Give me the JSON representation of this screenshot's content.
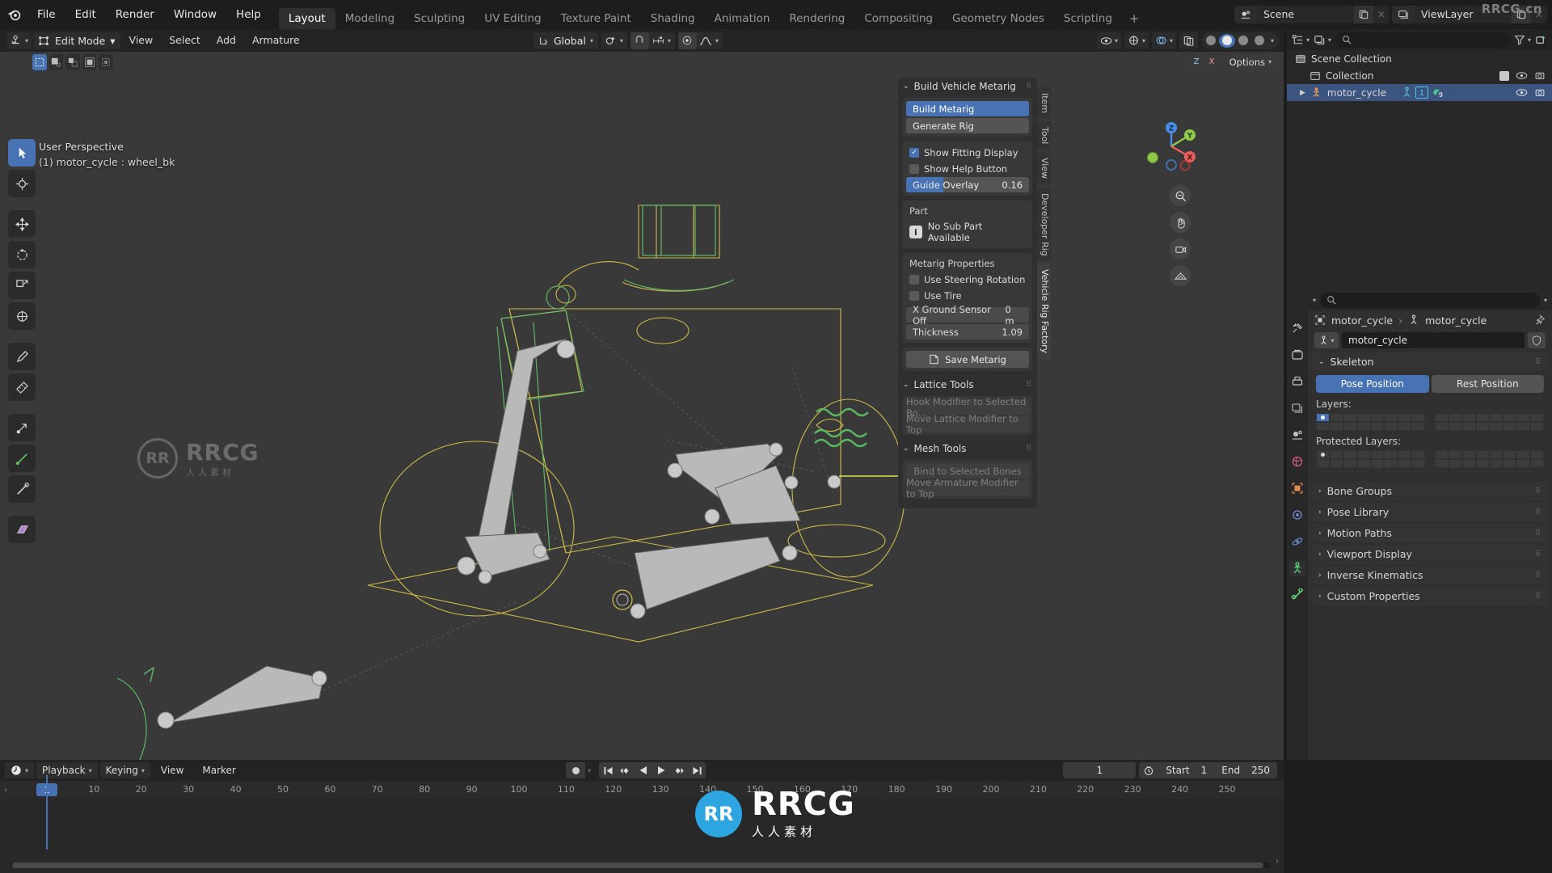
{
  "app": {
    "name": "Blender",
    "logo_icon": "blender-logo-icon"
  },
  "topbar": {
    "menus": [
      "File",
      "Edit",
      "Render",
      "Window",
      "Help"
    ],
    "workspace_tabs": [
      {
        "label": "Layout",
        "active": true
      },
      {
        "label": "Modeling",
        "active": false
      },
      {
        "label": "Sculpting",
        "active": false
      },
      {
        "label": "UV Editing",
        "active": false
      },
      {
        "label": "Texture Paint",
        "active": false
      },
      {
        "label": "Shading",
        "active": false
      },
      {
        "label": "Animation",
        "active": false
      },
      {
        "label": "Rendering",
        "active": false
      },
      {
        "label": "Compositing",
        "active": false
      },
      {
        "label": "Geometry Nodes",
        "active": false
      },
      {
        "label": "Scripting",
        "active": false
      }
    ],
    "add_workspace_label": "+",
    "scene": {
      "icon": "scene-icon",
      "name": "Scene",
      "new_label": "",
      "remove_label": "×"
    },
    "view_layer": {
      "icon": "view-layer-icon",
      "name": "ViewLayer",
      "new_label": "",
      "remove_label": "×"
    },
    "watermark": "RRCG.cn"
  },
  "viewport": {
    "mode": "Edit Mode",
    "menus": [
      "View",
      "Select",
      "Add",
      "Armature"
    ],
    "transform_orientation": "Global",
    "pivot_icon": "pivot-point-icon",
    "snap_icon": "snap-magnet-icon",
    "proportional_icon": "proportional-edit-icon",
    "falloff_icon": "falloff-curve-icon",
    "overlay_text_line1": "User Perspective",
    "overlay_text_line2": "(1) motor_cycle : wheel_bk",
    "select_modes": [
      "box-select-icon",
      "vertex-select-icon",
      "edge-select-icon",
      "face-select-icon",
      "extend-select-icon"
    ],
    "options_label": "Options",
    "gizmo_axes": [
      {
        "label": "Z",
        "color": "#4b8ee8"
      },
      {
        "label": "Y",
        "color": "#8fc94b"
      },
      {
        "label": "X",
        "color": "#e8615f"
      }
    ],
    "nav_buttons": [
      "zoom-icon",
      "pan-hand-icon",
      "camera-icon",
      "grid-ortho-icon"
    ],
    "shading_modes": [
      "wireframe-shading",
      "solid-shading",
      "material-shading",
      "rendered-shading"
    ],
    "active_shading_index": 1,
    "watermark_left": {
      "logo": "RR",
      "text": "RRCG",
      "sub": "人人素材"
    },
    "watermark_big": {
      "logo": "RR",
      "text": "RRCG",
      "sub": "人人素材"
    }
  },
  "sidebar_tabs": [
    {
      "label": "Item",
      "selected": false
    },
    {
      "label": "Tool",
      "selected": false
    },
    {
      "label": "View",
      "selected": false
    },
    {
      "label": "Developer Rig",
      "selected": false
    },
    {
      "label": "Vehicle Rig Factory",
      "selected": true
    }
  ],
  "npanel": {
    "sections": [
      {
        "title": "Build Vehicle Metarig",
        "collapsed": false,
        "buttons": [
          {
            "label": "Build Metarig",
            "highlight": true
          },
          {
            "label": "Generate Rig",
            "highlight": false
          }
        ],
        "checkboxes": [
          {
            "label": "Show Fitting Display",
            "checked": true
          },
          {
            "label": "Show Help Button",
            "checked": false
          }
        ],
        "slider": {
          "label": "Guide Overlay",
          "value": "0.16",
          "fill_percent": 30
        },
        "part_group": {
          "title": "Part",
          "info_icon": "info-icon",
          "info_text": "No Sub Part Available"
        },
        "metarig_props": {
          "title": "Metarig Properties",
          "checkboxes": [
            {
              "label": "Use Steering Rotation",
              "checked": false
            },
            {
              "label": "Use Tire",
              "checked": false
            }
          ],
          "fields": [
            {
              "label": "X Ground Sensor Off",
              "value": "0 m"
            },
            {
              "label": "Thickness",
              "value": "1.09"
            }
          ]
        },
        "save_button": {
          "label": "Save Metarig",
          "icon": "save-file-icon"
        }
      },
      {
        "title": "Lattice Tools",
        "collapsed": false,
        "disabled_buttons": [
          "Hook Modifier to Selected Bo...",
          "Move Lattice Modifier to Top"
        ]
      },
      {
        "title": "Mesh Tools",
        "collapsed": false,
        "disabled_buttons": [
          "Bind to Selected Bones",
          "Move Armature Modifier to Top"
        ]
      }
    ]
  },
  "outliner": {
    "display_mode_icon": "outliner-display-icon",
    "filter_icon": "filter-funnel-icon",
    "new_collection_icon": "new-collection-icon",
    "search_placeholder": "",
    "rows": [
      {
        "label": "Scene Collection",
        "icon": "scene-collection-icon",
        "indent": 0,
        "selected": false,
        "has_checkbox": false,
        "has_eye": false,
        "has_camera": false
      },
      {
        "label": "Collection",
        "icon": "collection-icon",
        "indent": 1,
        "selected": false,
        "has_checkbox": true,
        "checked": true,
        "has_eye": true,
        "has_camera": true
      },
      {
        "label": "motor_cycle",
        "icon": "armature-object-icon",
        "indent": 2,
        "selected": true,
        "has_checkbox": false,
        "has_eye": true,
        "has_camera": true,
        "badges": [
          "armature-data-icon",
          "pose-icon",
          "modifier-icon"
        ],
        "badge_count": "9"
      }
    ]
  },
  "properties": {
    "search_placeholder": "",
    "tabs": [
      {
        "name": "tool-icon",
        "selected": false
      },
      {
        "name": "render-icon",
        "selected": false
      },
      {
        "name": "output-printer-icon",
        "selected": false
      },
      {
        "name": "view-layer-icon",
        "selected": false
      },
      {
        "name": "scene-icon",
        "selected": false
      },
      {
        "name": "world-icon",
        "selected": false
      },
      {
        "name": "object-icon",
        "selected": false
      },
      {
        "name": "modifiers-icon",
        "selected": false
      },
      {
        "name": "physics-icon",
        "selected": false
      },
      {
        "name": "object-data-armature-icon",
        "selected": true
      },
      {
        "name": "bone-icon",
        "selected": false
      }
    ],
    "breadcrumb": [
      {
        "label": "motor_cycle",
        "icon": "object-icon"
      },
      {
        "label": "motor_cycle",
        "icon": "armature-data-icon"
      }
    ],
    "pin_icon": "pin-icon",
    "datablock": {
      "icon": "armature-data-icon",
      "name": "motor_cycle",
      "shield_icon": "fake-user-shield-icon"
    },
    "skeleton_panel": {
      "title": "Skeleton",
      "collapsed": false,
      "position_toggle": [
        {
          "label": "Pose Position",
          "active": true
        },
        {
          "label": "Rest Position",
          "active": false
        }
      ],
      "layers_label": "Layers:",
      "protected_layers_label": "Protected Layers:",
      "layers_active_index": 0,
      "protected_active_index": 0
    },
    "closed_panels": [
      "Bone Groups",
      "Pose Library",
      "Motion Paths",
      "Viewport Display",
      "Inverse Kinematics",
      "Custom Properties"
    ]
  },
  "timeline": {
    "editor_icon": "timeline-editor-icon",
    "menus": [
      {
        "label": "Playback",
        "dropdown": true
      },
      {
        "label": "Keying",
        "dropdown": true
      },
      {
        "label": "View",
        "dropdown": false
      },
      {
        "label": "Marker",
        "dropdown": false
      }
    ],
    "auto_key_icon": "record-dot-icon",
    "transport": [
      "jump-start-icon",
      "prev-keyframe-icon",
      "play-reverse-icon",
      "play-icon",
      "next-keyframe-icon",
      "jump-end-icon"
    ],
    "current_frame": "1",
    "frame_range": {
      "start_label": "Start",
      "start": "1",
      "end_label": "End",
      "end": "250",
      "clock_icon": "clock-icon"
    },
    "ruler_ticks": [
      "1",
      "10",
      "20",
      "30",
      "40",
      "50",
      "60",
      "70",
      "80",
      "90",
      "100",
      "110",
      "120",
      "130",
      "140",
      "150",
      "160",
      "170",
      "180",
      "190",
      "200",
      "210",
      "220",
      "230",
      "240",
      "250"
    ],
    "playhead_frame": "1"
  },
  "colors": {
    "accent_blue": "#4772b3",
    "bg_dark": "#1d1d1d",
    "bg_panel": "#303030",
    "viewport_bg": "#393939",
    "armature_orange": "#e8b84b",
    "yellow_blob": "#FFE600"
  }
}
